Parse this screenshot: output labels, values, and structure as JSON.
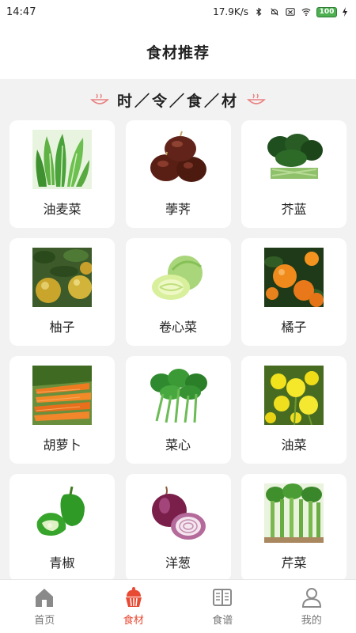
{
  "status_bar": {
    "time": "14:47",
    "network_speed": "17.9K/s",
    "battery": "100",
    "icons": [
      "bluetooth-icon",
      "mute-icon",
      "sim-icon",
      "wifi-icon",
      "battery-icon",
      "charging-icon"
    ]
  },
  "header": {
    "title": "食材推荐"
  },
  "section": {
    "title": "时／令／食／材"
  },
  "foods": [
    {
      "label": "油麦菜",
      "icon": "leafy-greens-photo"
    },
    {
      "label": "荸荠",
      "icon": "water-chestnut-photo"
    },
    {
      "label": "芥蓝",
      "icon": "kale-photo"
    },
    {
      "label": "柚子",
      "icon": "pomelo-photo"
    },
    {
      "label": "卷心菜",
      "icon": "cabbage-photo"
    },
    {
      "label": "橘子",
      "icon": "tangerine-photo"
    },
    {
      "label": "胡萝卜",
      "icon": "carrot-photo"
    },
    {
      "label": "菜心",
      "icon": "choy-sum-photo"
    },
    {
      "label": "油菜",
      "icon": "rapeseed-flower-photo"
    },
    {
      "label": "青椒",
      "icon": "green-pepper-photo"
    },
    {
      "label": "洋葱",
      "icon": "onion-photo"
    },
    {
      "label": "芹菜",
      "icon": "celery-photo"
    }
  ],
  "tabs": [
    {
      "label": "首页",
      "icon": "home-icon"
    },
    {
      "label": "食材",
      "icon": "cupcake-icon",
      "active": true
    },
    {
      "label": "食谱",
      "icon": "recipe-book-icon"
    },
    {
      "label": "我的",
      "icon": "user-icon"
    }
  ],
  "colors": {
    "accent": "#e84a33",
    "background": "#f2f2f2",
    "card": "#ffffff",
    "inactive": "#777777"
  }
}
